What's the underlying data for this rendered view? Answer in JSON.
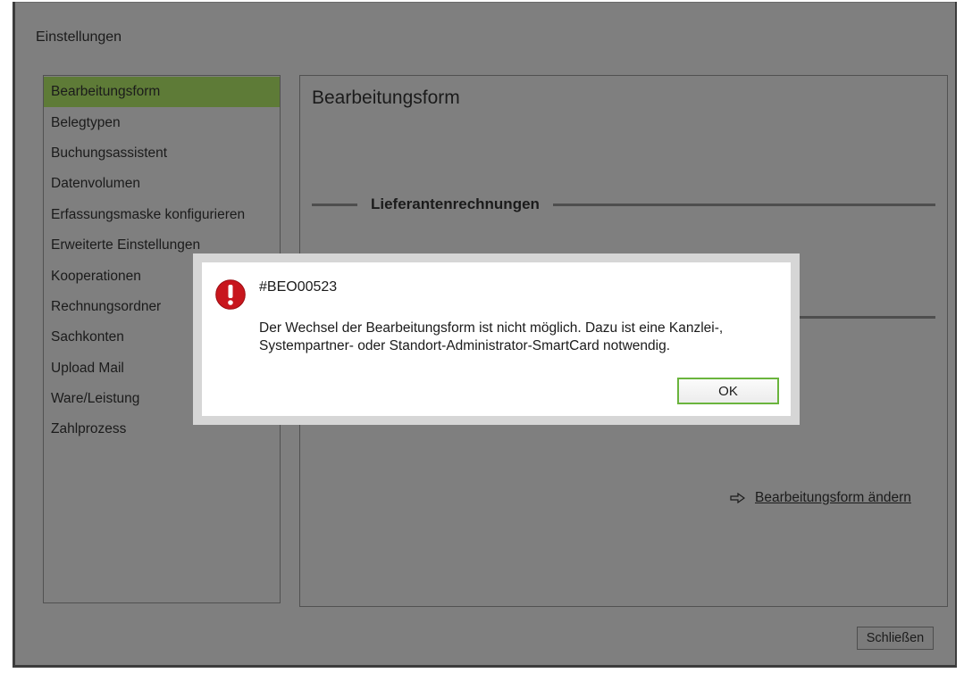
{
  "window": {
    "title": "Einstellungen",
    "close_button": "Schließen"
  },
  "sidebar": {
    "selected_index": 0,
    "items": [
      {
        "label": "Bearbeitungsform"
      },
      {
        "label": "Belegtypen"
      },
      {
        "label": "Buchungsassistent"
      },
      {
        "label": "Datenvolumen"
      },
      {
        "label": "Erfassungsmaske konfigurieren"
      },
      {
        "label": "Erweiterte Einstellungen"
      },
      {
        "label": "Kooperationen"
      },
      {
        "label": "Rechnungsordner"
      },
      {
        "label": "Sachkonten"
      },
      {
        "label": "Upload Mail"
      },
      {
        "label": "Ware/Leistung"
      },
      {
        "label": "Zahlprozess"
      }
    ]
  },
  "main": {
    "title": "Bearbeitungsform",
    "section_heading": "Lieferantenrechnungen",
    "action": {
      "icon": "arrow-right-icon",
      "link": "Bearbeitungsform ändern"
    }
  },
  "dialog": {
    "icon": "error-icon",
    "code": "#BEO00523",
    "message_lines": [
      "Der Wechsel der Bearbeitungsform ist nicht möglich. Dazu ist eine Kanzlei-,",
      "Systempartner- oder Standort-Administrator-SmartCard notwendig."
    ],
    "ok_button": "OK"
  },
  "colors": {
    "window_bg": "#7f7f7f",
    "selected_bg": "#5e7b37",
    "dialog_frame": "#d6d6d6",
    "error_red": "#c8161d",
    "ok_border": "#6ab43d"
  }
}
